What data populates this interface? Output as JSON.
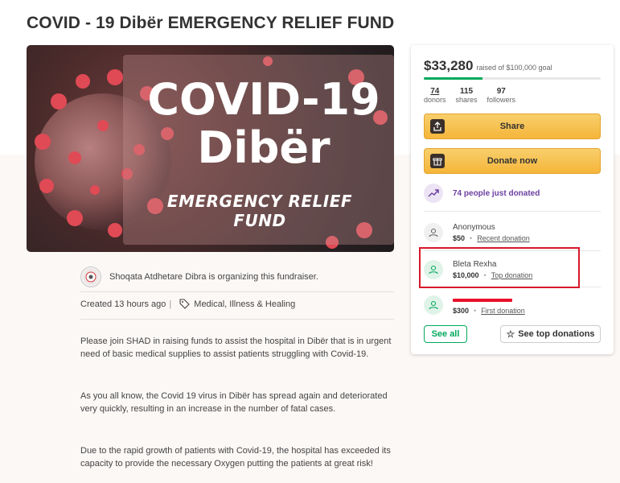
{
  "page": {
    "title": "COVID - 19 Dibër EMERGENCY RELIEF FUND"
  },
  "hero": {
    "line1": "COVID-19",
    "line2": "Dibër",
    "line3": "EMERGENCY RELIEF FUND"
  },
  "organizer": {
    "text": "Shoqata Atdhetare Dibra is organizing this fundraiser."
  },
  "meta": {
    "created": "Created 13 hours ago",
    "category": "Medical, Illness & Healing"
  },
  "story": [
    "Please join SHAD in raising funds to assist the hospital in Dibër that is in urgent need of basic medical supplies to assist patients struggling with Covid-19.",
    "As you all know, the Covid 19 virus in Dibër has spread again and deteriorated very quickly, resulting in an increase in the number of fatal cases.",
    "Due to the rapid growth of patients with Covid-19, the hospital has exceeded its capacity to provide the necessary Oxygen putting the patients at great risk!"
  ],
  "fund": {
    "raised": "$33,280",
    "goal_text": "raised of $100,000 goal",
    "progress_fraction": 0.33,
    "donors_count": "74",
    "donors_label": "donors",
    "shares_count": "115",
    "shares_label": "shares",
    "followers_count": "97",
    "followers_label": "followers"
  },
  "actions": {
    "share_label": "Share",
    "donate_label": "Donate now",
    "see_all_label": "See all",
    "see_top_label": "See top donations"
  },
  "trend": {
    "text": "74 people just donated"
  },
  "donations": [
    {
      "name": "Anonymous",
      "amount": "$50",
      "kind": "Recent donation"
    },
    {
      "name": "Bleta Rexha",
      "amount": "$10,000",
      "kind": "Top donation"
    },
    {
      "name": "",
      "amount": "$300",
      "kind": "First donation"
    }
  ],
  "colors": {
    "accent_green": "#02a95c",
    "button_yellow": "#f5b53a",
    "trend_purple": "#6b3fa0",
    "highlight_red": "#d7182a"
  }
}
